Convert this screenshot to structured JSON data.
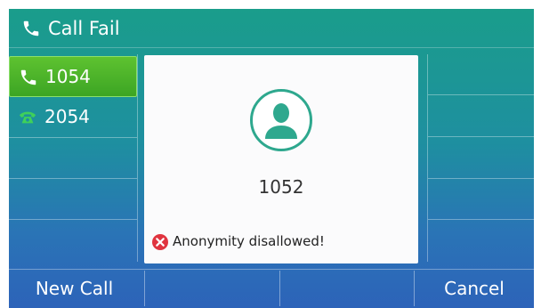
{
  "header": {
    "title": "Call Fail",
    "icon": "phone-icon"
  },
  "lines": [
    {
      "label": "1054",
      "icon": "phone-handset-icon",
      "active": true
    },
    {
      "label": "2054",
      "icon": "desk-phone-icon",
      "active": false
    }
  ],
  "call": {
    "number": "1052",
    "avatar_icon": "contact-avatar-icon",
    "error_icon": "error-x-icon",
    "error_message": "Anonymity disallowed!"
  },
  "softkeys": [
    {
      "label": "New Call"
    },
    {
      "label": ""
    },
    {
      "label": ""
    },
    {
      "label": "Cancel"
    }
  ],
  "colors": {
    "accent_green": "#4cb52a",
    "avatar_ring": "#2ea88e",
    "error_red": "#e0343f"
  }
}
